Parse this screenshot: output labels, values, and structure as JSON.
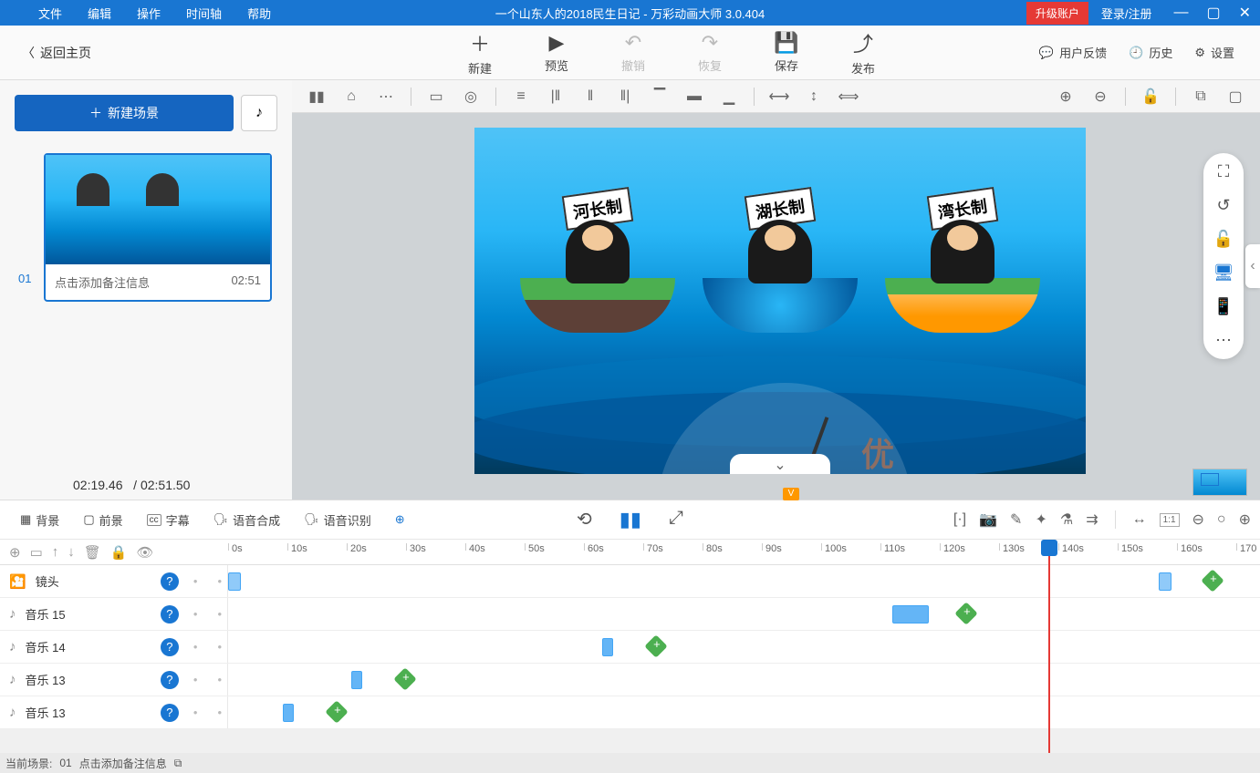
{
  "title_bar": {
    "menus": [
      "文件",
      "编辑",
      "操作",
      "时间轴",
      "帮助"
    ],
    "document_title": "一个山东人的2018民生日记 - 万彩动画大师 3.0.404",
    "upgrade": "升级账户",
    "login": "登录/注册"
  },
  "toolbar": {
    "back": "返回主页",
    "buttons": [
      {
        "label": "新建",
        "icon": "＋"
      },
      {
        "label": "预览",
        "icon": "▶"
      },
      {
        "label": "撤销",
        "icon": "↶",
        "disabled": true
      },
      {
        "label": "恢复",
        "icon": "↷",
        "disabled": true
      },
      {
        "label": "保存",
        "icon": "💾"
      },
      {
        "label": "发布",
        "icon": "⤴"
      }
    ],
    "right_links": [
      {
        "label": "用户反馈",
        "icon": "💬"
      },
      {
        "label": "历史",
        "icon": "🕘"
      },
      {
        "label": "设置",
        "icon": "⚙"
      }
    ]
  },
  "left_panel": {
    "new_scene": "新建场景",
    "scene_number": "01",
    "note_placeholder": "点击添加备注信息",
    "scene_duration": "02:51",
    "current_time": "02:19.46",
    "total_time": "02:51.50"
  },
  "canvas": {
    "signs": [
      "河长制",
      "湖长制",
      "湾长制"
    ],
    "gauge_label": "优"
  },
  "timeline_tabs": [
    {
      "icon": "▦",
      "label": "背景"
    },
    {
      "icon": "▢",
      "label": "前景"
    },
    {
      "icon": "cc",
      "label": "字幕"
    },
    {
      "icon": "🗣",
      "label": "语音合成"
    },
    {
      "icon": "🗣",
      "label": "语音识别"
    }
  ],
  "ruler_ticks": [
    "0s",
    "10s",
    "20s",
    "30s",
    "40s",
    "50s",
    "60s",
    "70s",
    "80s",
    "90s",
    "100s",
    "110s",
    "120s",
    "130s",
    "140s",
    "150s",
    "160s",
    "170"
  ],
  "tracks": [
    {
      "name": "镜头",
      "icon": "🎦"
    },
    {
      "name": "音乐 15",
      "icon": "♪"
    },
    {
      "name": "音乐 14",
      "icon": "♪"
    },
    {
      "name": "音乐 13",
      "icon": "♪"
    },
    {
      "name": "音乐 13",
      "icon": "♪"
    }
  ],
  "status": {
    "scene_label": "当前场景:",
    "scene_num": "01",
    "note": "点击添加备注信息"
  }
}
